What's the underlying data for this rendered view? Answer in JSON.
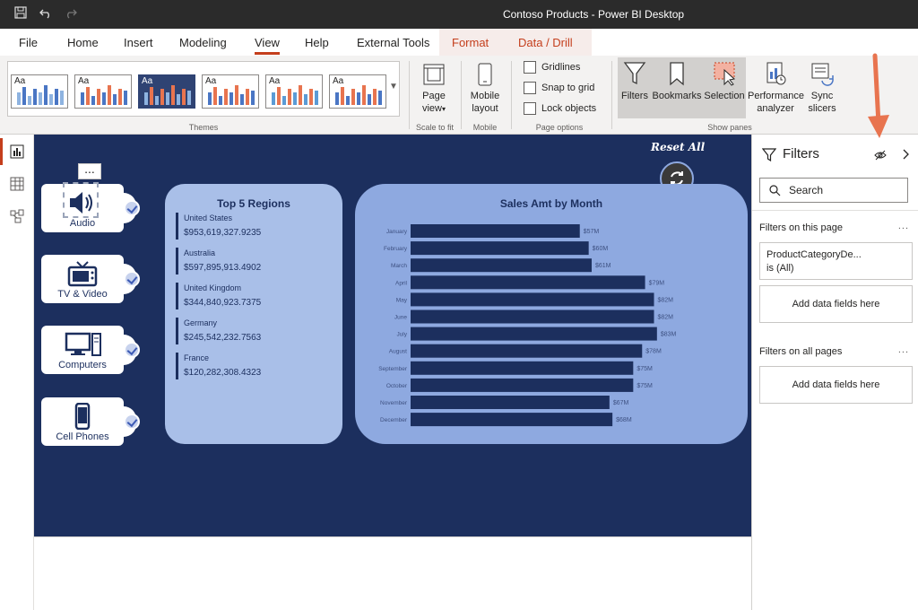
{
  "window": {
    "title": "Contoso Products - Power BI Desktop"
  },
  "menu": {
    "tabs": [
      "File",
      "Home",
      "Insert",
      "Modeling",
      "View",
      "Help",
      "External Tools"
    ],
    "active": "View",
    "context_tabs": [
      "Format",
      "Data / Drill"
    ]
  },
  "ribbon": {
    "themes": {
      "label": "Themes",
      "sample": "Aa"
    },
    "scale": {
      "button": "Page view",
      "button_line1": "Page",
      "button_line2": "view",
      "label": "Scale to fit"
    },
    "mobile": {
      "button_line1": "Mobile",
      "button_line2": "layout",
      "label": "Mobile"
    },
    "page_options": {
      "items": [
        "Gridlines",
        "Snap to grid",
        "Lock objects"
      ],
      "label": "Page options"
    },
    "show_panes": {
      "filters": "Filters",
      "bookmarks": "Bookmarks",
      "selection": "Selection",
      "performance_line1": "Performance",
      "performance_line2": "analyzer",
      "sync_line1": "Sync",
      "sync_line2": "slicers",
      "label": "Show panes"
    }
  },
  "report": {
    "reset_label": "Reset All",
    "slicers": [
      "Audio",
      "TV & Video",
      "Computers",
      "Cell Phones"
    ],
    "dots": "...",
    "regions": {
      "title": "Top 5 Regions",
      "items": [
        {
          "name": "United States",
          "value": "$953,619,327.9235"
        },
        {
          "name": "Australia",
          "value": "$597,895,913.4902"
        },
        {
          "name": "United Kingdom",
          "value": "$344,840,923.7375"
        },
        {
          "name": "Germany",
          "value": "$245,542,232.7563"
        },
        {
          "name": "France",
          "value": "$120,282,308.4323"
        }
      ]
    }
  },
  "chart_data": {
    "type": "bar",
    "orientation": "horizontal",
    "title": "Sales Amt by Month",
    "categories": [
      "January",
      "February",
      "March",
      "April",
      "May",
      "June",
      "July",
      "August",
      "September",
      "October",
      "November",
      "December"
    ],
    "values": [
      57,
      60,
      61,
      79,
      82,
      82,
      83,
      78,
      75,
      75,
      67,
      68
    ],
    "labels": [
      "$57M",
      "$60M",
      "$61M",
      "$79M",
      "$82M",
      "$82M",
      "$83M",
      "$78M",
      "$75M",
      "$75M",
      "$67M",
      "$68M"
    ],
    "unit": "M",
    "xlim": [
      0,
      90
    ],
    "grid": false,
    "bar_color": "#1c2f5e"
  },
  "filters": {
    "title": "Filters",
    "search_placeholder": "Search",
    "on_page_label": "Filters on this page",
    "card_field": "ProductCategoryDe...",
    "card_value": "is (All)",
    "add_fields": "Add data fields here",
    "all_pages_label": "Filters on all pages",
    "more": "..."
  },
  "colors": {
    "accent": "#c43e1c",
    "report_bg": "#1c2f5e",
    "card_light": "#a9bfe8",
    "card_mid": "#8ea9e0",
    "arrow": "#e8744f"
  }
}
